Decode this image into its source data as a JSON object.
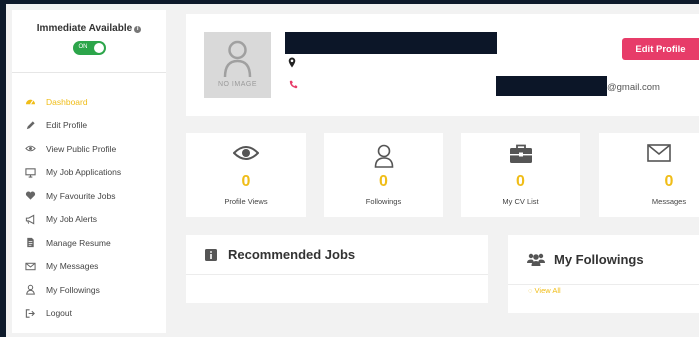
{
  "sidebar": {
    "availability": {
      "title": "Immediate Available",
      "toggle_label": "ON"
    },
    "items": [
      {
        "label": "Dashboard",
        "icon": "dashboard-icon",
        "active": true
      },
      {
        "label": "Edit Profile",
        "icon": "pencil-icon"
      },
      {
        "label": "View Public Profile",
        "icon": "eye-icon"
      },
      {
        "label": "My Job Applications",
        "icon": "monitor-icon"
      },
      {
        "label": "My Favourite Jobs",
        "icon": "heart-icon"
      },
      {
        "label": "My Job Alerts",
        "icon": "megaphone-icon"
      },
      {
        "label": "Manage Resume",
        "icon": "file-icon"
      },
      {
        "label": "My Messages",
        "icon": "envelope-icon"
      },
      {
        "label": "My Followings",
        "icon": "user-icon"
      },
      {
        "label": "Logout",
        "icon": "logout-icon"
      }
    ]
  },
  "profile": {
    "no_image_text": "NO IMAGE",
    "email_suffix": "@gmail.com",
    "edit_button": "Edit Profile"
  },
  "stats": [
    {
      "value": "0",
      "label": "Profile Views",
      "icon": "eye-icon"
    },
    {
      "value": "0",
      "label": "Followings",
      "icon": "user-icon"
    },
    {
      "value": "0",
      "label": "My CV List",
      "icon": "briefcase-icon"
    },
    {
      "value": "0",
      "label": "Messages",
      "icon": "envelope-icon"
    }
  ],
  "panels": {
    "recommended": {
      "title": "Recommended Jobs"
    },
    "followings": {
      "title": "My Followings",
      "view_all": "View All"
    }
  },
  "colors": {
    "accent": "#f0bd18",
    "edit_button": "#e73c69",
    "toggle": "#2ca54a",
    "background": "#f2f2f2"
  }
}
